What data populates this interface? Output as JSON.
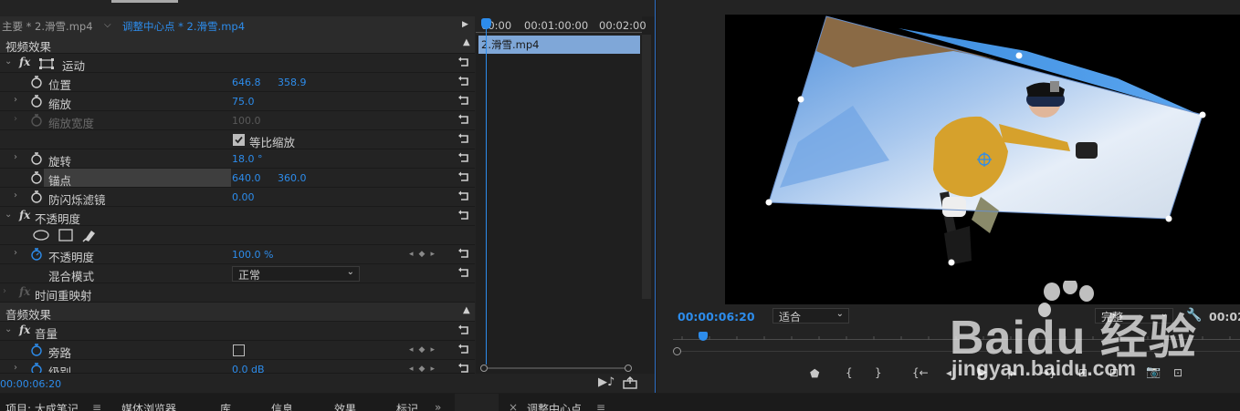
{
  "top_tabs": {
    "source_tab": "主要 * 2.滑雪.mp4",
    "active_tab": "调整中心点 * 2.滑雪.mp4"
  },
  "ruler": {
    "t0": "00:00",
    "t1": "00:01:00:00",
    "t2": "00:02:00"
  },
  "clip_name": "2.滑雪.mp4",
  "effects": {
    "video_header": "视频效果",
    "motion": "运动",
    "position_label": "位置",
    "position_x": "646.8",
    "position_y": "358.9",
    "scale_label": "缩放",
    "scale_value": "75.0",
    "scale_width_label": "缩放宽度",
    "scale_width_value": "100.0",
    "uniform_scale_label": "等比缩放",
    "rotation_label": "旋转",
    "rotation_value": "18.0 °",
    "anchor_label": "锚点",
    "anchor_x": "640.0",
    "anchor_y": "360.0",
    "flicker_label": "防闪烁滤镜",
    "flicker_value": "0.00",
    "opacity_group": "不透明度",
    "opacity_label": "不透明度",
    "opacity_value": "100.0 %",
    "blend_label": "混合模式",
    "blend_value": "正常",
    "time_remap": "时间重映射",
    "audio_header": "音频效果",
    "volume_group": "音量",
    "bypass_label": "旁路",
    "level_label": "级别",
    "level_value": "0.0 dB"
  },
  "ec_timecode": "00:00:06:20",
  "monitor": {
    "timecode": "00:00:06:20",
    "fit_label": "适合",
    "quality_label": "完整",
    "duration_partial": "00:02"
  },
  "bottom_tabs": {
    "project": "项目: 大成笔记",
    "media_browser": "媒体浏览器",
    "library": "库",
    "info": "信息",
    "effects": "效果",
    "markers": "标记",
    "sequence": "调整中心点"
  },
  "watermark": {
    "brand": "Baidu 经验",
    "url": "jingyan.baidu.com"
  },
  "colors": {
    "accent": "#2d8ceb",
    "clip": "#7fa7d8",
    "panel": "#232323"
  }
}
